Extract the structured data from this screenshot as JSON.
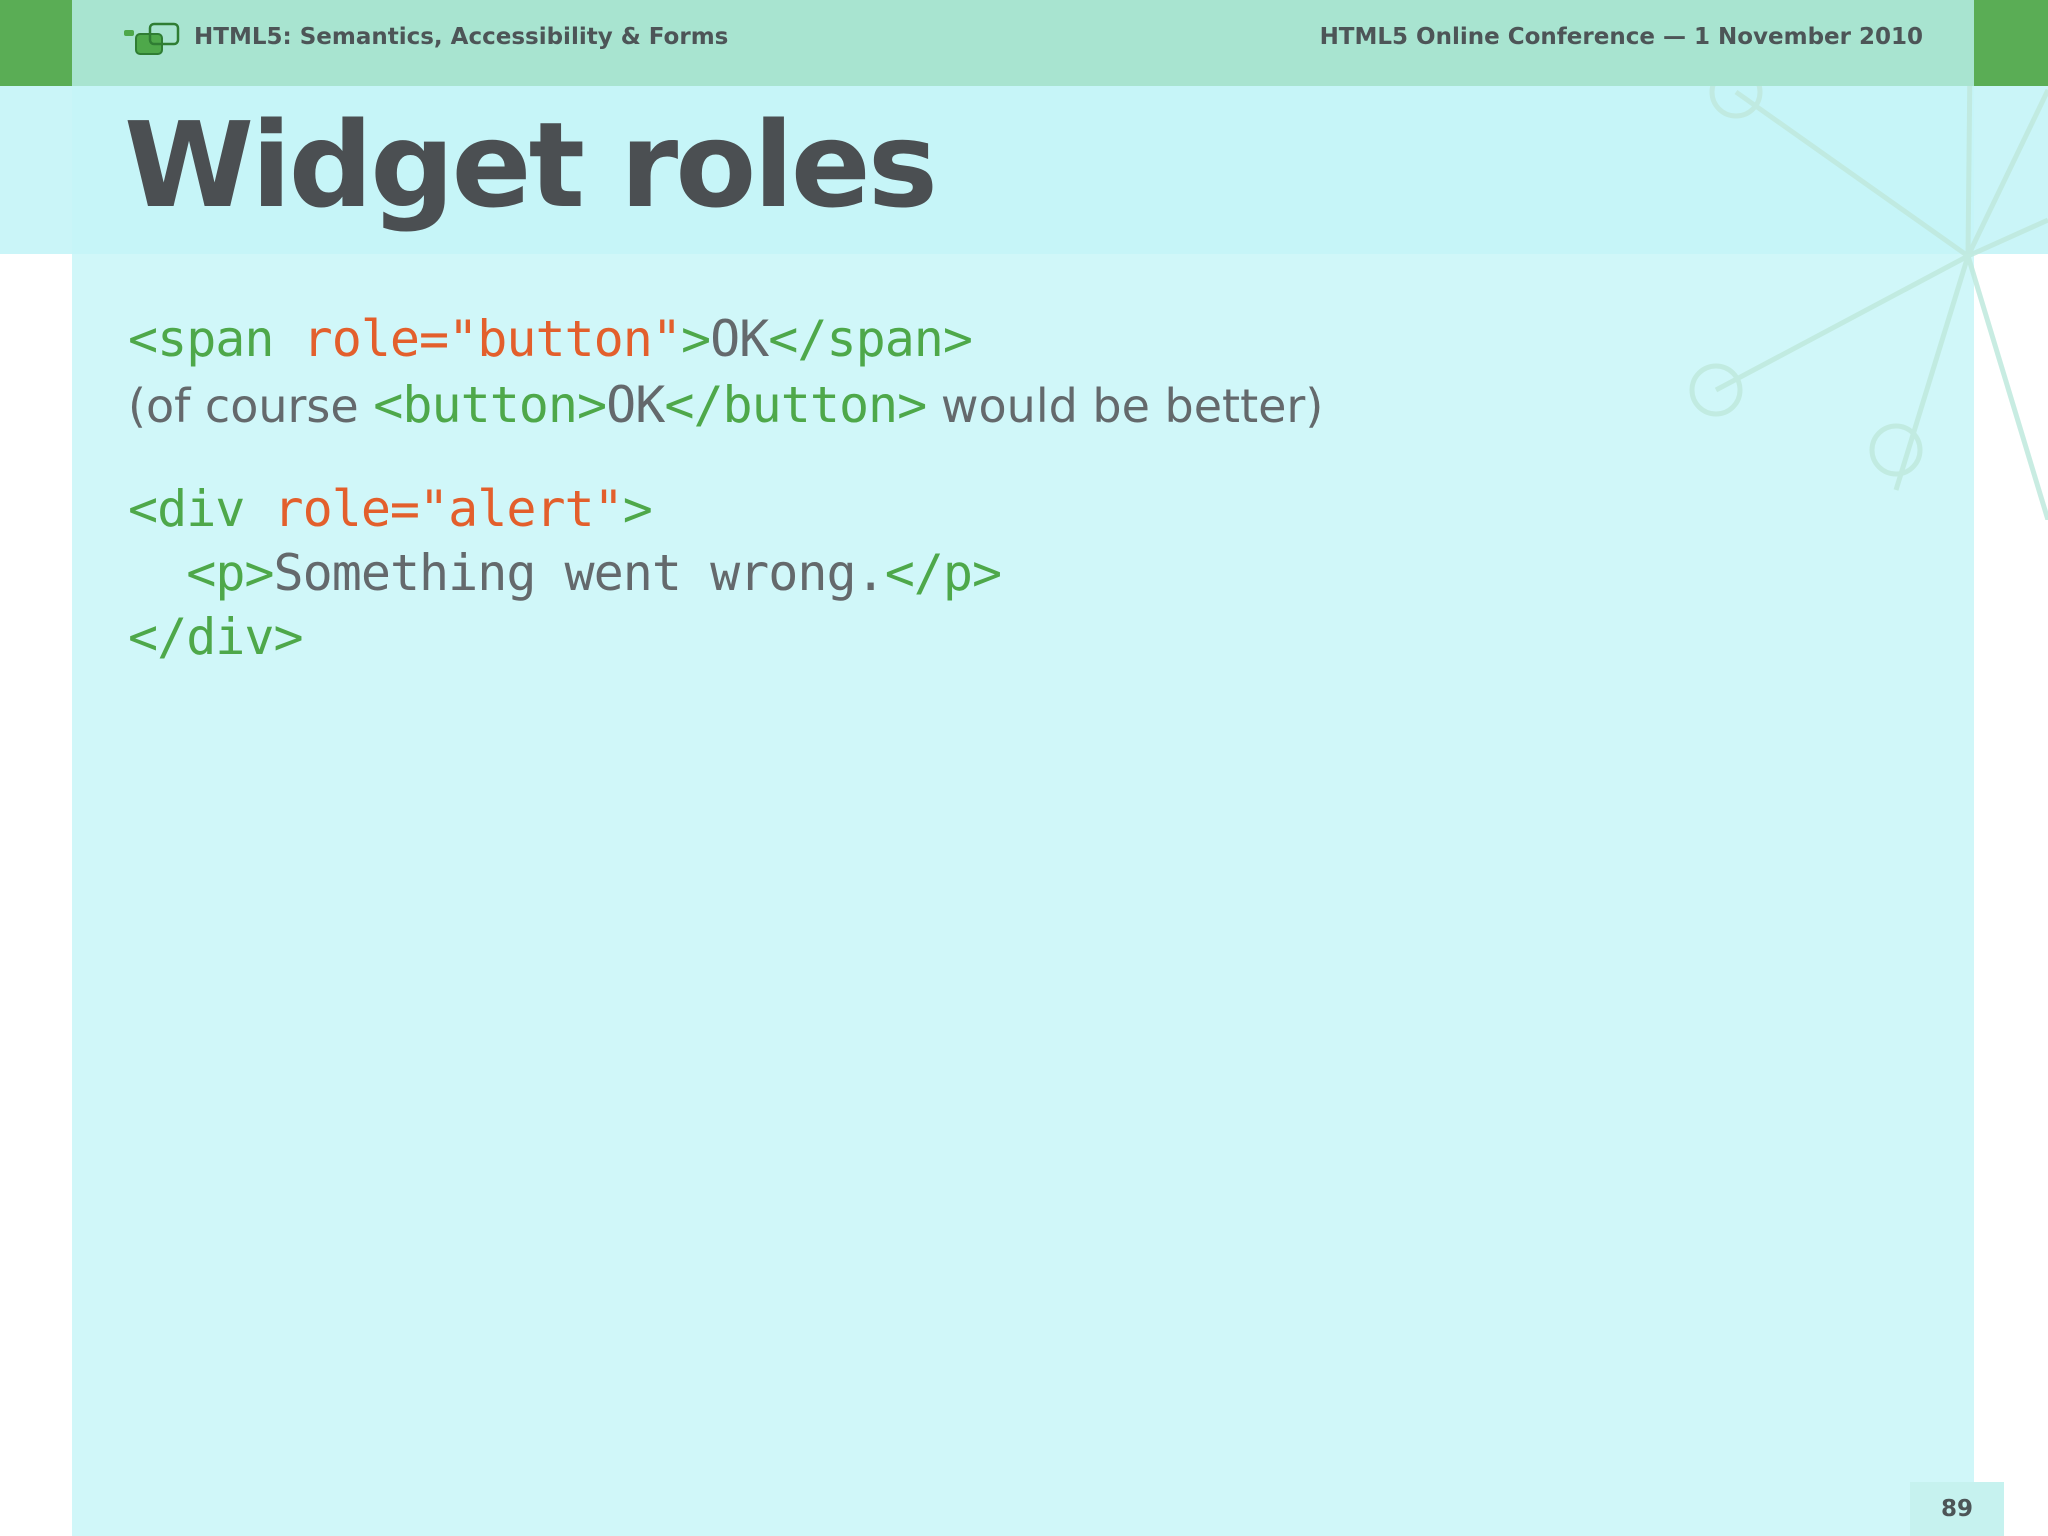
{
  "header": {
    "left_text": "HTML5: Semantics, Accessibility & Forms",
    "right_text": "HTML5 Online Conference — 1 November 2010",
    "logo_icon": "chat-bubbles-logo"
  },
  "slide": {
    "title": "Widget roles",
    "example1": {
      "open_tag": "<span ",
      "role_attr": "role=\"button\"",
      "gt": ">",
      "text": "OK",
      "close_tag": "</span>"
    },
    "note": {
      "prefix": "(of course ",
      "open_tag": "<button>",
      "text": "OK",
      "close_tag": "</button>",
      "suffix": " would be better)"
    },
    "example2": {
      "open_tag": "<div ",
      "role_attr": "role=\"alert\"",
      "gt": ">",
      "indent": "  ",
      "p_open": "<p>",
      "p_text": "Something went wrong.",
      "p_close": "</p>",
      "close_tag": "</div>"
    },
    "page_number": "89"
  },
  "colors": {
    "header_bar": "#a8e4d0",
    "side_strip": "#5aad55",
    "panel": "#d0f7f9",
    "tag": "#4ea84a",
    "attribute": "#e35f2c",
    "text": "#64696c",
    "title": "#4b4f52"
  }
}
